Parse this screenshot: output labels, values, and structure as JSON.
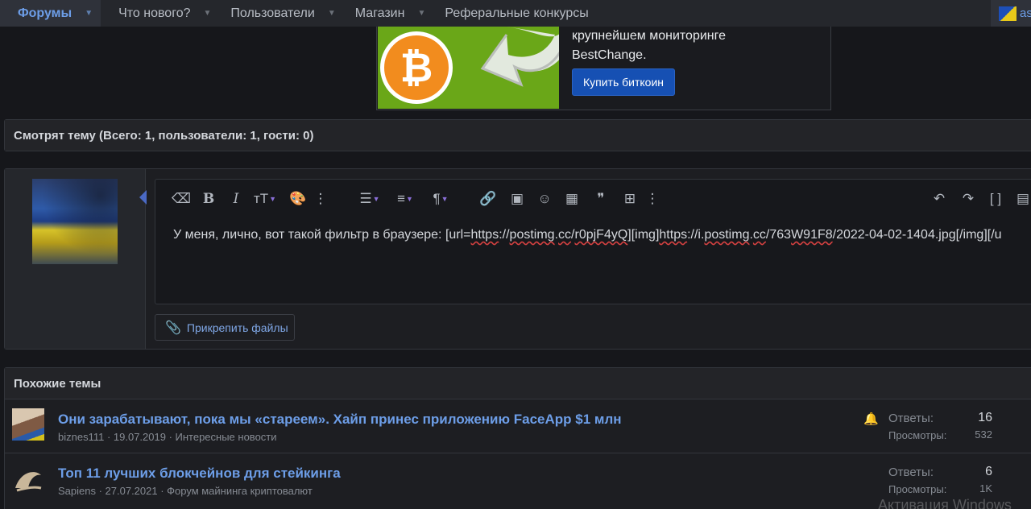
{
  "nav": {
    "items": [
      {
        "label": "Форумы",
        "active": true
      },
      {
        "label": "Что нового?"
      },
      {
        "label": "Пользователи"
      },
      {
        "label": "Магазин"
      },
      {
        "label": "Реферальные конкурсы"
      }
    ],
    "user_label": "ass"
  },
  "ad": {
    "line1": "крупнейшем мониторинге",
    "line2": "BestChange.",
    "button": "Купить биткоин",
    "coin_symbol": "₿"
  },
  "watching": {
    "title": "Смотрят тему (Всего: 1, пользователи: 1, гости: 0)"
  },
  "editor": {
    "text_plain": "У меня, лично, вот такой фильтр в браузере: [url=",
    "text_u1": "https",
    "text_2": "://",
    "text_u2": "postimg",
    "text_3": ".",
    "text_u3": "cc",
    "text_4": "/",
    "text_u4": "r0pjF4yQ",
    "text_5": "][img]",
    "text_u5": "https",
    "text_6": "://i.",
    "text_u6": "postimg",
    "text_7": ".",
    "text_u7": "cc",
    "text_8": "/763",
    "text_u8": "W91F8",
    "text_9": "/2022-04-02-1404.jpg[/img][/u",
    "attach_label": "Прикрепить файлы"
  },
  "similar": {
    "title": "Похожие темы",
    "threads": [
      {
        "title": "Они зарабатывают, пока мы «стареем». Хайп принес приложению FaceApp $1 млн",
        "meta": "biznes111 · 19.07.2019 · Интересные новости",
        "replies_label": "Ответы:",
        "replies": "16",
        "views_label": "Просмотры:",
        "views": "532"
      },
      {
        "title": "Топ 11 лучших блокчейнов для стейкинга",
        "meta": "Sapiens · 27.07.2021 · Форум майнинга криптовалют",
        "replies_label": "Ответы:",
        "replies": "6",
        "views_label": "Просмотры:",
        "views": "1K"
      }
    ]
  },
  "watermark": "Активация Windows",
  "colors": {
    "accent": "#6d9ee8",
    "button_blue": "#1650b3",
    "ad_green": "#6aa718",
    "bitcoin_orange": "#f28c1e"
  }
}
